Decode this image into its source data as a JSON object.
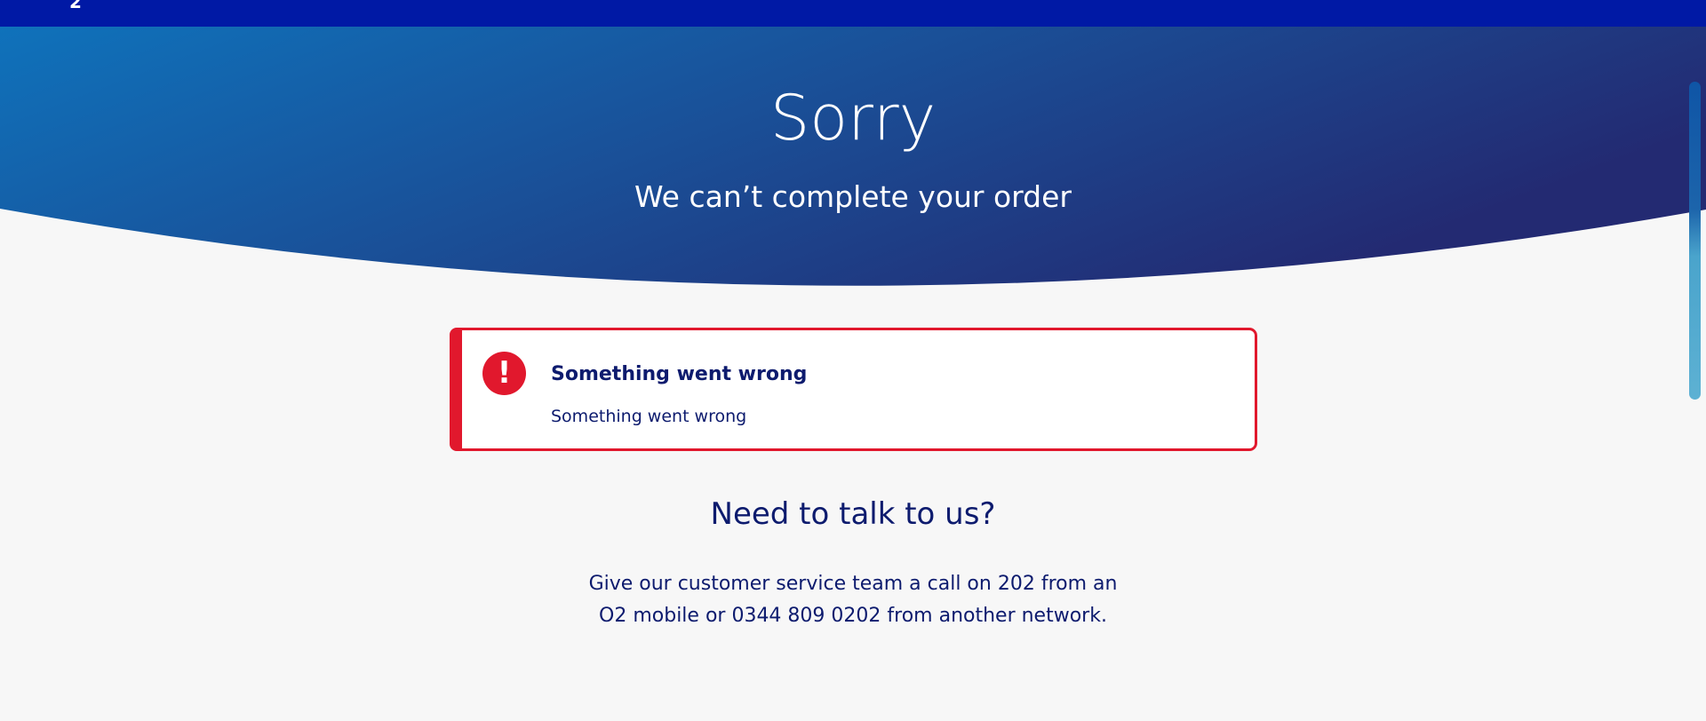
{
  "header": {
    "logo_glyph": "2"
  },
  "hero": {
    "title": "Sorry",
    "subtitle": "We can’t complete your order"
  },
  "error": {
    "icon_symbol": "!",
    "title": "Something went wrong",
    "message": "Something went wrong"
  },
  "contact": {
    "heading": "Need to talk to us?",
    "line1": "Give our customer service team a call on 202 from an",
    "line2": "O2 mobile or 0344 809 0202 from another network."
  },
  "colors": {
    "nav": "#0019a5",
    "hero_start": "#0f72bb",
    "hero_end": "#232a72",
    "error_red": "#e1182d",
    "text_navy": "#0d1b6e",
    "background": "#f7f7f7"
  },
  "icons": {
    "error": "exclamation-circle-icon",
    "logo": "o2-logo-icon"
  }
}
